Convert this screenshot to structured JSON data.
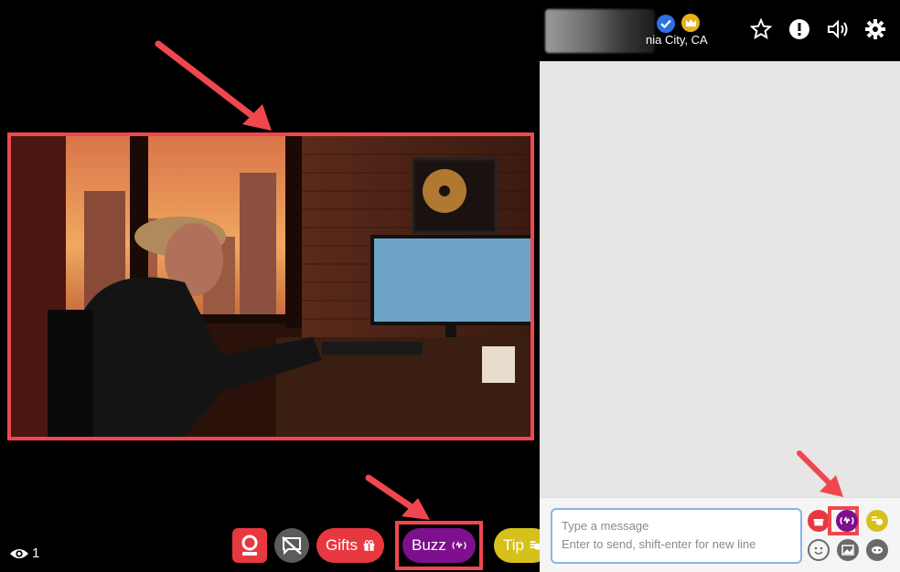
{
  "header": {
    "location": "nia City, CA"
  },
  "viewers": {
    "count": "1"
  },
  "controls": {
    "gifts_label": "Gifts",
    "buzz_label": "Buzz",
    "tip_label": "Tip"
  },
  "compose": {
    "placeholder_line1": "Type a message",
    "placeholder_line2": "Enter to send, shift-enter for new line"
  },
  "colors": {
    "accent_red": "#e8383f",
    "buzz_purple": "#7e0f8e",
    "tip_yellow": "#d6c11c",
    "annotation_red": "#f0474f"
  },
  "icons": [
    "webcam-icon",
    "chat-off-icon",
    "gift-icon",
    "vibrate-icon",
    "coins-icon",
    "eye-icon",
    "star-icon",
    "alert-icon",
    "speaker-icon",
    "gear-icon",
    "verified-icon",
    "crown-icon",
    "emoji-icon",
    "image-icon",
    "mask-icon"
  ]
}
